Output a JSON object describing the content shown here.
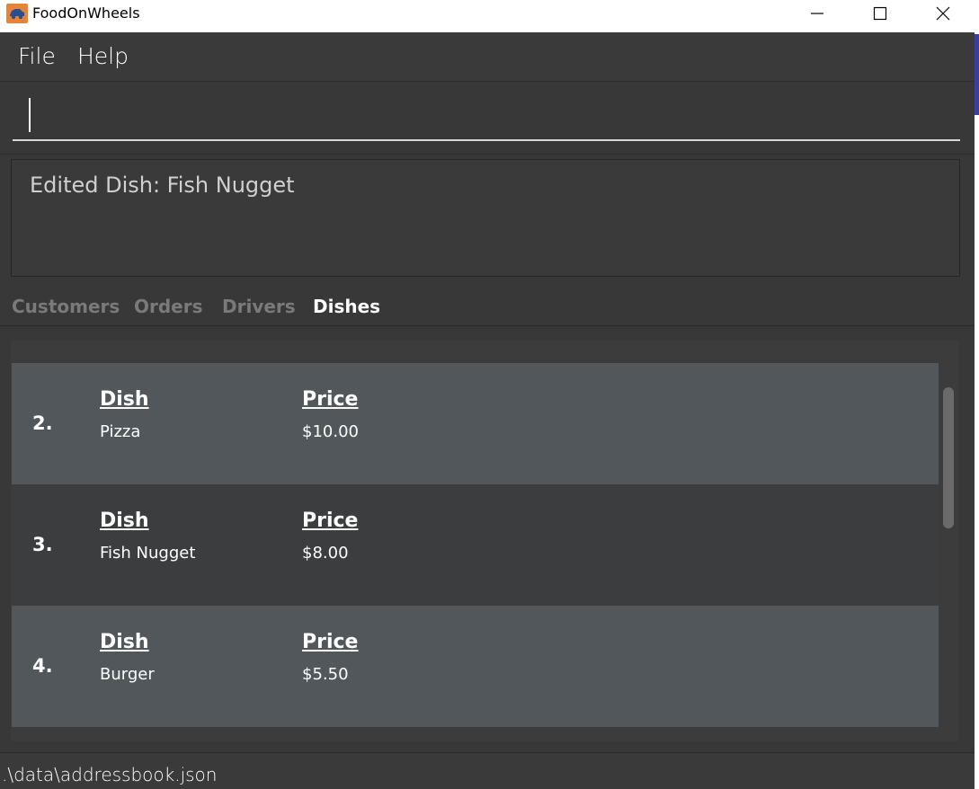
{
  "window": {
    "title": "FoodOnWheels",
    "icon": "car-logo-icon",
    "brand_color": "#e8843a"
  },
  "menu": {
    "file": "File",
    "help": "Help"
  },
  "command": {
    "value": "",
    "placeholder": ""
  },
  "result": {
    "message": "Edited Dish: Fish Nugget"
  },
  "tabs": [
    {
      "label": "Customers",
      "active": false
    },
    {
      "label": "Orders",
      "active": false
    },
    {
      "label": "Drivers",
      "active": false
    },
    {
      "label": "Dishes",
      "active": true
    }
  ],
  "dishes": {
    "dish_header": "Dish",
    "price_header": "Price",
    "items": [
      {
        "index": "2.",
        "name": "Pizza",
        "price": "$10.00"
      },
      {
        "index": "3.",
        "name": "Fish Nugget",
        "price": "$8.00"
      },
      {
        "index": "4.",
        "name": "Burger",
        "price": "$5.50"
      }
    ]
  },
  "status": {
    "path": ".\\data\\addressbook.json"
  }
}
